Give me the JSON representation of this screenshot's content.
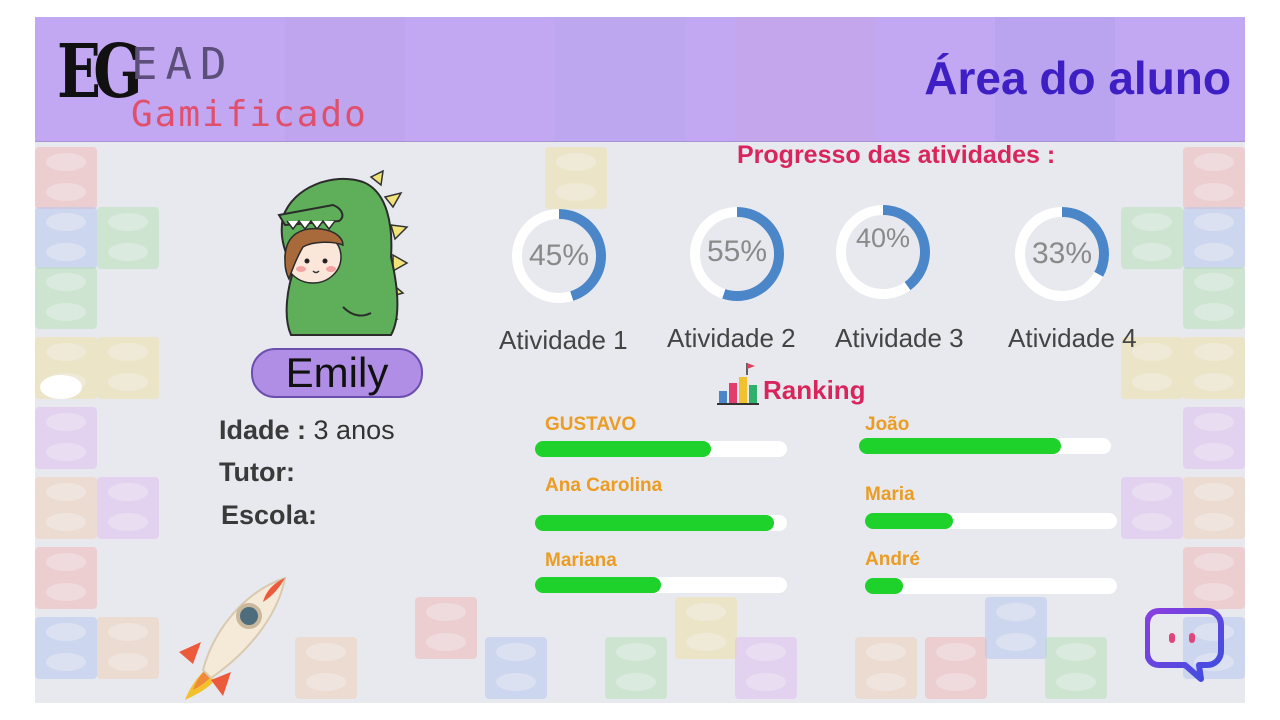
{
  "logo": {
    "mark": "EG",
    "line1": "EAD",
    "line2": "Gamificado"
  },
  "header": {
    "title": "Área do aluno"
  },
  "progress": {
    "title": "Progresso das atividades :",
    "activities": [
      {
        "label": "Atividade 1",
        "percent_text": "45%",
        "value": 45
      },
      {
        "label": "Atividade 2",
        "percent_text": "55%",
        "value": 55
      },
      {
        "label": "Atividade 3",
        "percent_text": "40%",
        "value": 40
      },
      {
        "label": "Atividade 4",
        "percent_text": "33%",
        "value": 33
      }
    ]
  },
  "student": {
    "name": "Emily",
    "age_label": "Idade :",
    "age_value": "3 anos",
    "tutor_label": "Tutor:",
    "school_label": "Escola:"
  },
  "ranking": {
    "title": "Ranking",
    "entries": [
      {
        "name": "GUSTAVO",
        "fraction": 0.7
      },
      {
        "name": "João",
        "fraction": 0.8
      },
      {
        "name": "Ana Carolina",
        "fraction": 0.95
      },
      {
        "name": "Maria",
        "fraction": 0.35
      },
      {
        "name": "Mariana",
        "fraction": 0.5
      },
      {
        "name": "André",
        "fraction": 0.15
      }
    ]
  },
  "colors": {
    "header_bg": "#c2a8f2",
    "title": "#3d1fc4",
    "accent_pink": "#d8265c",
    "gauge_fill": "#4a86c8",
    "ranking_name": "#eb9c23",
    "ranking_bar": "#1ed12b",
    "name_pill": "#b08ee6"
  },
  "icons": [
    "dinosaur-avatar-icon",
    "ranking-chart-icon",
    "rocket-icon",
    "chat-bubble-icon"
  ]
}
